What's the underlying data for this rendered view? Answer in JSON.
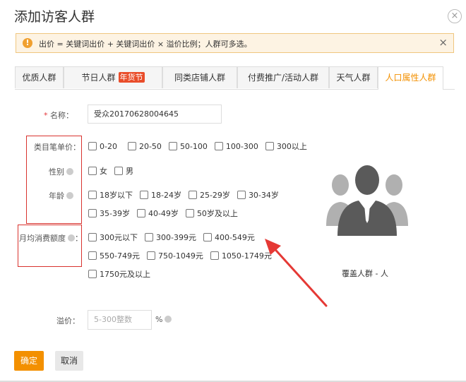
{
  "dialog": {
    "title": "添加访客人群",
    "close_icon": "close-icon",
    "close_glyph": "×"
  },
  "notice": {
    "icon": "warning-icon",
    "icon_glyph": "!",
    "text": "出价 = 关键词出价 + 关键词出价 × 溢价比例；人群可多选。",
    "close_glyph": "×"
  },
  "tabs": [
    {
      "label": "优质人群"
    },
    {
      "label": "节日人群",
      "badge": "年货节"
    },
    {
      "label": "同类店铺人群"
    },
    {
      "label": "付费推广/活动人群"
    },
    {
      "label": "天气人群"
    },
    {
      "label": "人口属性人群",
      "active": true
    }
  ],
  "form": {
    "name_required_mark": "*",
    "name_label": "名称：",
    "name_value": "受众20170628004645",
    "category_price_label": "类目笔单价：",
    "category_price_options": [
      "0-20",
      "20-50",
      "50-100",
      "100-300",
      "300以上"
    ],
    "gender_label": "性别",
    "gender_options": [
      "女",
      "男"
    ],
    "age_label": "年龄",
    "age_options_row1": [
      "18岁以下",
      "18-24岁",
      "25-29岁",
      "30-34岁"
    ],
    "age_options_row2": [
      "35-39岁",
      "40-49岁",
      "50岁及以上"
    ],
    "monthly_spend_label": "月均消费额度",
    "monthly_spend_row1": [
      "300元以下",
      "300-399元",
      "400-549元"
    ],
    "monthly_spend_row2": [
      "550-749元",
      "750-1049元",
      "1050-1749元"
    ],
    "monthly_spend_row3": [
      "1750元及以上"
    ],
    "premium_label": "溢价：",
    "premium_placeholder": "5-300整数",
    "premium_unit": "%"
  },
  "coverage": {
    "avatar_icon": "people-group-icon",
    "text": "覆盖人群 - 人"
  },
  "buttons": {
    "ok": "确定",
    "cancel": "取消"
  },
  "colors": {
    "accent": "#f39000",
    "highlight_box": "#d9332e",
    "arrow": "#e53935",
    "badge": "#e94d2a"
  }
}
